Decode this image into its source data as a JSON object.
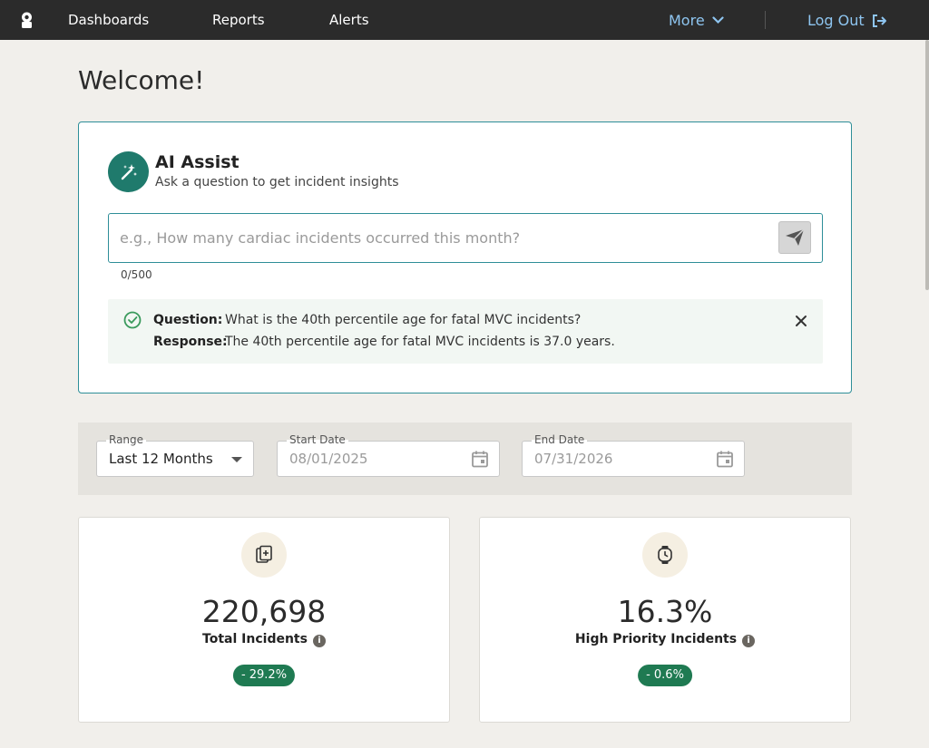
{
  "nav": {
    "logo_icon": "badge-icon",
    "links": [
      "Dashboards",
      "Reports",
      "Alerts"
    ],
    "more_label": "More",
    "logout_label": "Log Out",
    "accent_color": "#8ec5f0"
  },
  "page": {
    "title": "Welcome!"
  },
  "ai_assist": {
    "icon": "magic-wand-icon",
    "title": "AI Assist",
    "subtitle": "Ask a question to get incident insights",
    "input_placeholder": "e.g., How many cardiac incidents occurred this month?",
    "input_value": "",
    "counter": "0/500",
    "question_label": "Question:",
    "question_text": "What is the 40th percentile age for fatal MVC incidents?",
    "response_label": "Response:",
    "response_text": "The 40th percentile age for fatal MVC incidents is 37.0 years.",
    "accent_color": "#1f7a6c"
  },
  "filters": {
    "range_label": "Range",
    "range_value": "Last 12 Months",
    "start_label": "Start Date",
    "start_value": "08/01/2025",
    "end_label": "End Date",
    "end_value": "07/31/2026"
  },
  "stats": [
    {
      "icon": "medical-records-icon",
      "value": "220,698",
      "label": "Total Incidents",
      "change": "- 29.2%"
    },
    {
      "icon": "stopwatch-icon",
      "value": "16.3%",
      "label": "High Priority Incidents",
      "change": "- 0.6%"
    }
  ]
}
